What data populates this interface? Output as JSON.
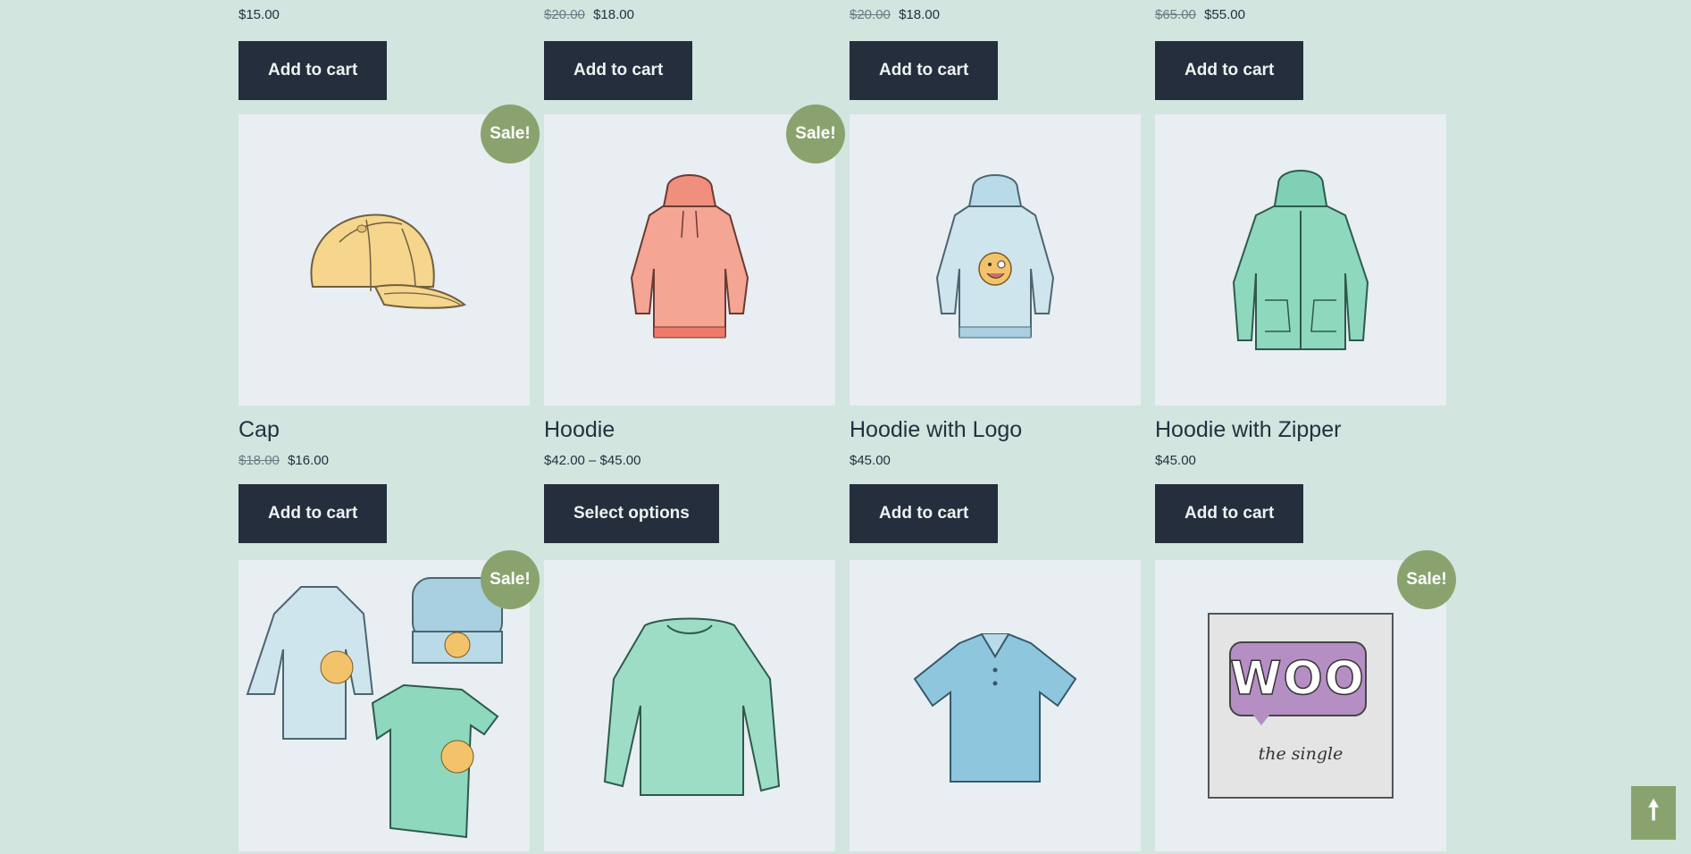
{
  "colors": {
    "background": "#d2e5df",
    "button": "#242e3d",
    "sale_badge": "#8aa36e",
    "thumb_bg": "#e8eef2"
  },
  "top_row": [
    {
      "price": "$15.00",
      "old_price": "",
      "button": "Add to cart"
    },
    {
      "price": "$18.00",
      "old_price": "$20.00",
      "button": "Add to cart"
    },
    {
      "price": "$18.00",
      "old_price": "$20.00",
      "button": "Add to cart"
    },
    {
      "price": "$55.00",
      "old_price": "$65.00",
      "button": "Add to cart"
    }
  ],
  "products": [
    {
      "name": "Cap",
      "old_price": "$18.00",
      "price": "$16.00",
      "button": "Add to cart",
      "sale": "Sale!",
      "image": "cap-image"
    },
    {
      "name": "Hoodie",
      "old_price": "",
      "price": "$42.00 – $45.00",
      "button": "Select options",
      "sale": "Sale!",
      "image": "hoodie-image"
    },
    {
      "name": "Hoodie with Logo",
      "old_price": "",
      "price": "$45.00",
      "button": "Add to cart",
      "sale": "",
      "image": "hoodie-logo-image"
    },
    {
      "name": "Hoodie with Zipper",
      "old_price": "",
      "price": "$45.00",
      "button": "Add to cart",
      "sale": "",
      "image": "hoodie-zipper-image"
    }
  ],
  "bottom_row": [
    {
      "sale": "Sale!",
      "image": "logo-collection-image"
    },
    {
      "sale": "",
      "image": "long-sleeve-tee-image"
    },
    {
      "sale": "",
      "image": "polo-image"
    },
    {
      "sale": "Sale!",
      "image": "woo-single-image",
      "album_text": "the single",
      "logo_text": "WOO"
    }
  ],
  "back_to_top": {
    "icon": "arrow-up-icon",
    "glyph": "🠕"
  }
}
